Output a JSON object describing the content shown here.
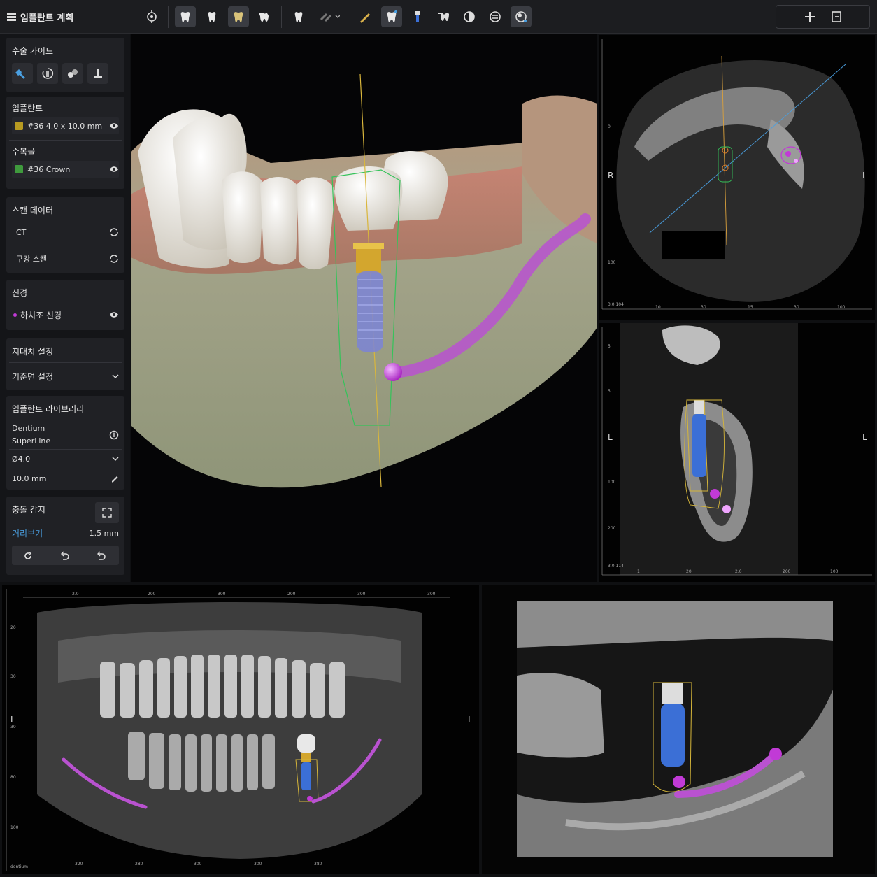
{
  "app": {
    "title": "임플란트 계획"
  },
  "toolbar": {
    "icons": [
      "target-icon",
      "tooth-icon",
      "tooth-icon",
      "tooth-icon",
      "tooth-icon",
      "tooth-icon",
      "bone-icon",
      "pen-icon",
      "tooth-icon",
      "implant-icon",
      "teeth-icon",
      "contrast-icon",
      "nerve-icon",
      "sphere-icon"
    ],
    "right_icons": [
      "crosshair-icon",
      "panel-icon"
    ]
  },
  "sidebar": {
    "surgical_guide": {
      "title": "수술 가이드"
    },
    "implant": {
      "title": "임플란트",
      "item": "#36 4.0 x 10.0 mm",
      "color": "#b79a21"
    },
    "restoration": {
      "title": "수복물",
      "item": "#36 Crown",
      "color": "#3f9a3d"
    },
    "scan_data": {
      "title": "스캔 데이터",
      "items": [
        "CT",
        "구강 스캔"
      ]
    },
    "nerve": {
      "title": "신경",
      "item": "하치조 신경",
      "color": "#c13ad6"
    },
    "abutment": {
      "title": "지대치 설정"
    },
    "reference": {
      "title": "기준면 설정"
    },
    "library": {
      "title": "임플란트 라이브러리",
      "brand": "Dentium",
      "model": "SuperLine",
      "diameter": "Ø4.0",
      "length": "10.0 mm"
    },
    "collision": {
      "title": "충돌 감지",
      "distance_label": "거리브기",
      "distance_value": "1.5 mm"
    }
  },
  "views": {
    "axial": {
      "left": "R",
      "right": "L",
      "ticks_x": [
        "10",
        "30",
        "15",
        "30",
        "100"
      ],
      "ticks_y": [
        "0",
        "100"
      ],
      "corner": "3.0 104"
    },
    "cross": {
      "left": "L",
      "right": "L",
      "ticks_x": [
        "1",
        "20",
        "2.0",
        "200",
        "100"
      ],
      "ticks_y": [
        "5",
        "5",
        "100",
        "200"
      ],
      "corner": "3.0 114"
    },
    "panoramic": {
      "left": "L",
      "right": "L",
      "ticks_x": [
        "2.0",
        "200",
        "300",
        "200",
        "300",
        "300"
      ],
      "ticks_y": [
        "20",
        "30",
        "30",
        "80",
        "100"
      ],
      "ticks_bottom": [
        "320",
        "280",
        "300",
        "300",
        "380"
      ],
      "corner": "dentium"
    }
  },
  "colors": {
    "accent": "#4a9fe0",
    "nerve": "#c13ad6",
    "implant": "#3b6fd6",
    "guide": "#e8c83a"
  }
}
